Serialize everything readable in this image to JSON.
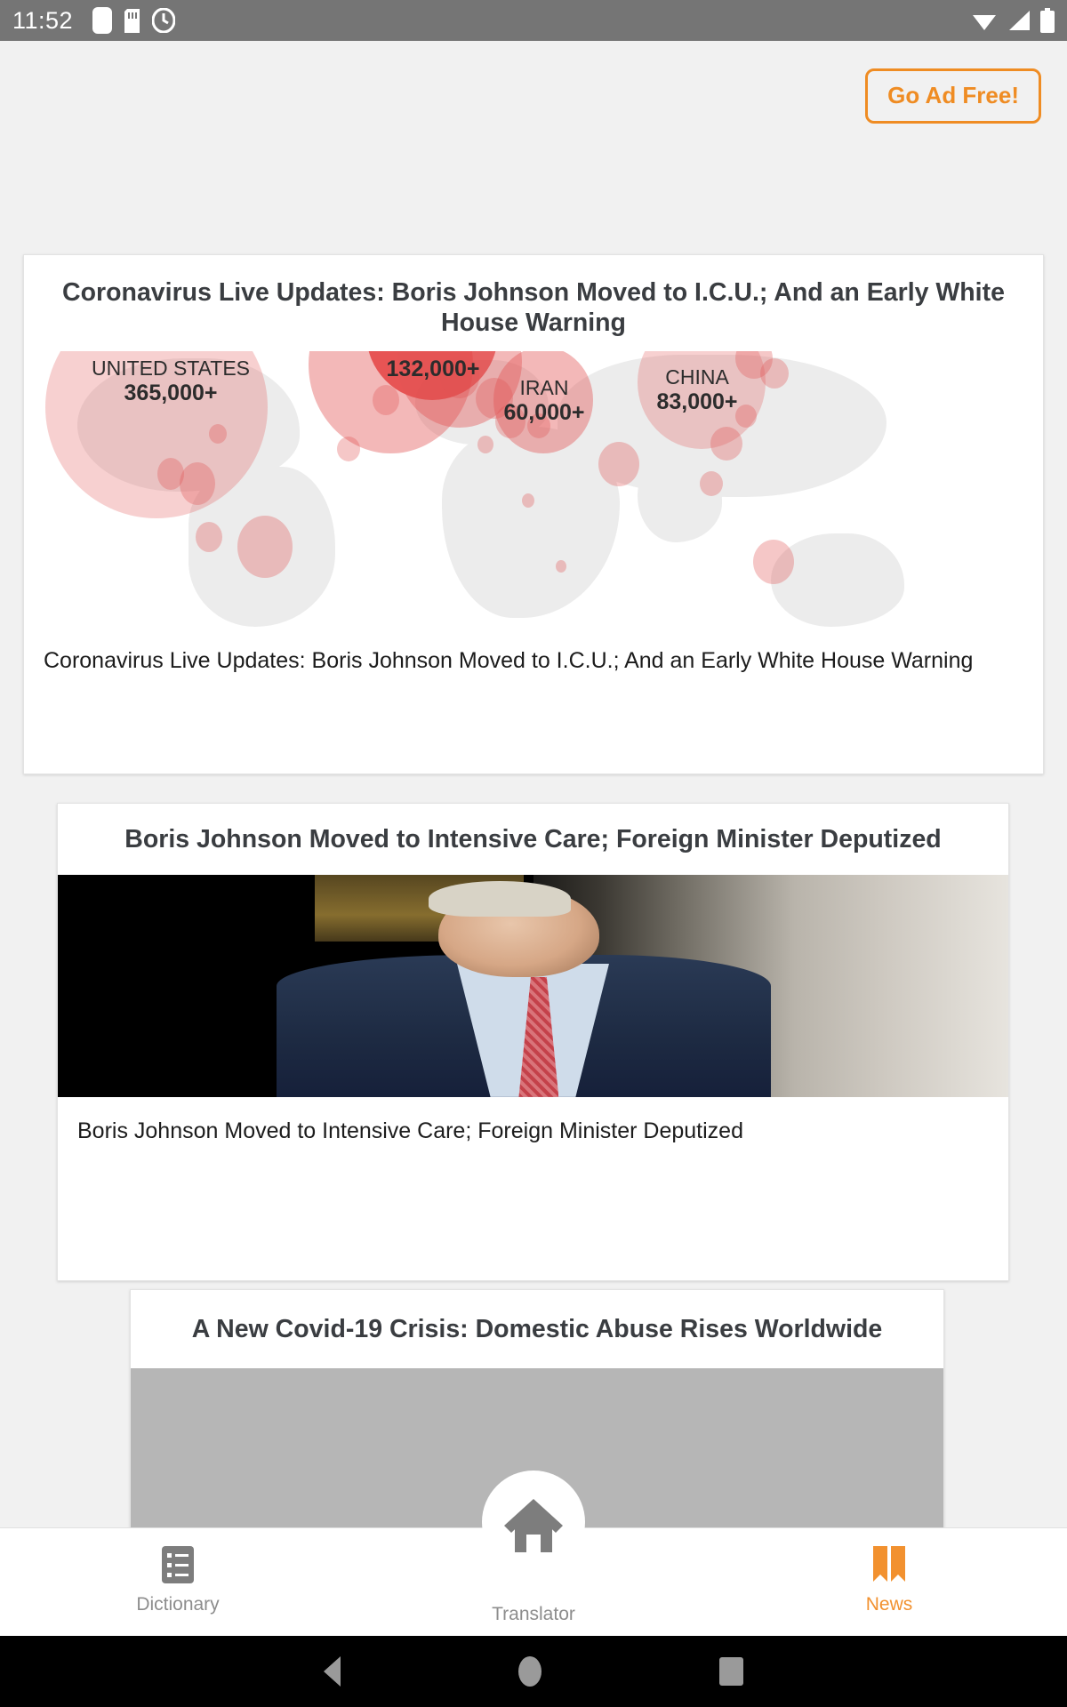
{
  "status_bar": {
    "time": "11:52",
    "left_icons": [
      "notification-square-icon",
      "sd-card-icon",
      "clock-icon"
    ],
    "right_icons": [
      "wifi-icon",
      "signal-icon",
      "battery-icon"
    ]
  },
  "header": {
    "ad_free_label": "Go Ad Free!",
    "accent_color": "#ef8c23"
  },
  "feed": {
    "cards": [
      {
        "title": "Coronavirus Live Updates: Boris Johnson Moved to I.C.U.; And an Early White House Warning",
        "caption": "Coronavirus Live Updates: Boris Johnson Moved to I.C.U.; And an Early White House Warning",
        "image_type": "covid-world-bubble-map"
      },
      {
        "title": "Boris Johnson Moved to Intensive Care; Foreign Minister Deputized",
        "caption": "Boris Johnson Moved to Intensive Care; Foreign Minister Deputized",
        "image_type": "photo-boris-johnson"
      },
      {
        "title": "A New Covid-19 Crisis: Domestic Abuse Rises Worldwide",
        "caption": "",
        "image_type": "gray-placeholder"
      }
    ]
  },
  "map_labels": [
    {
      "country": "UNITED STATES",
      "cases": "365,000+"
    },
    {
      "country": "",
      "cases": "132,000+"
    },
    {
      "country": "IRAN",
      "cases": "60,000+"
    },
    {
      "country": "CHINA",
      "cases": "83,000+"
    }
  ],
  "bottom_nav": {
    "items": [
      {
        "label": "Dictionary",
        "icon": "list-icon",
        "active": false
      },
      {
        "label": "Translator",
        "icon": "home-icon",
        "active": false
      },
      {
        "label": "News",
        "icon": "book-bookmark-icon",
        "active": true
      }
    ],
    "active_color": "#f2912f",
    "inactive_color": "#8d8d8d"
  },
  "system_nav": {
    "back": "back-triangle-icon",
    "home": "home-circle-icon",
    "recents": "recents-square-icon"
  }
}
